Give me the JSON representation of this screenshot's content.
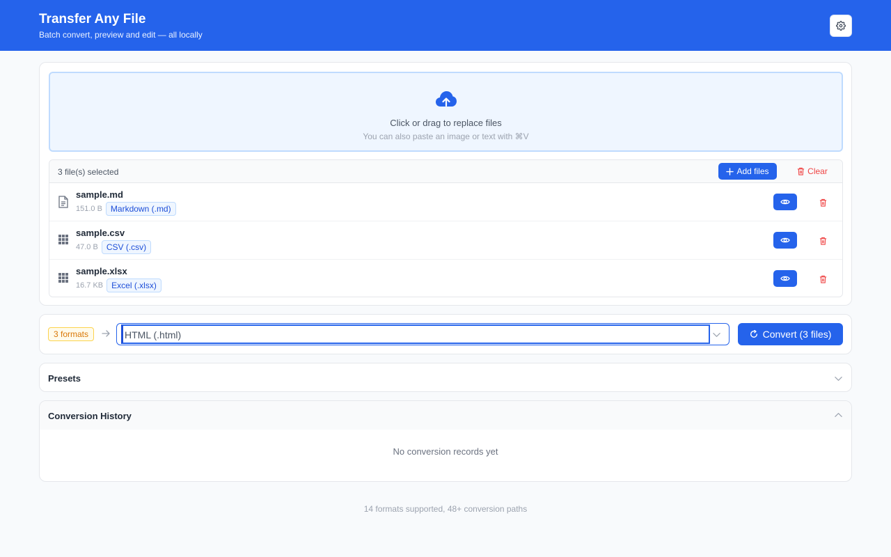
{
  "header": {
    "title": "Transfer Any File",
    "subtitle": "Batch convert, preview and edit — all locally",
    "settings_icon": "gear-icon"
  },
  "dropzone": {
    "icon": "cloud-upload-icon",
    "main_text": "Click or drag to replace files",
    "sub_text": "You can also paste an image or text with ⌘V"
  },
  "filelist": {
    "count_text": "3 file(s) selected",
    "add_label": "Add files",
    "clear_label": "Clear",
    "files": [
      {
        "name": "sample.md",
        "size": "151.0 B",
        "format": "Markdown (.md)",
        "icon": "document-icon"
      },
      {
        "name": "sample.csv",
        "size": "47.0 B",
        "format": "CSV (.csv)",
        "icon": "grid-icon"
      },
      {
        "name": "sample.xlsx",
        "size": "16.7 KB",
        "format": "Excel (.xlsx)",
        "icon": "grid-icon"
      }
    ]
  },
  "convert": {
    "formats_badge": "3 formats",
    "selected_format": "HTML (.html)",
    "button_label": "Convert (3 files)"
  },
  "presets": {
    "title": "Presets"
  },
  "history": {
    "title": "Conversion History",
    "empty_text": "No conversion records yet"
  },
  "footer": {
    "text": "14 formats supported, 48+ conversion paths"
  },
  "colors": {
    "primary": "#2563eb",
    "danger": "#ef4444",
    "warning": "#d97706"
  }
}
